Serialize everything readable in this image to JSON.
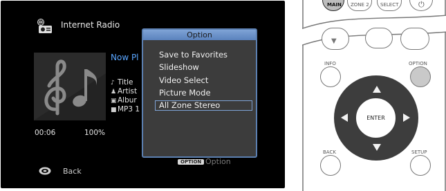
{
  "screen": {
    "app_title": "Internet Radio",
    "now_playing": "Now Pl",
    "tags": [
      {
        "label": "Title"
      },
      {
        "label": "Artist"
      },
      {
        "label": "Albur"
      },
      {
        "label": "MP3 1"
      }
    ],
    "time": "00:06",
    "percent": "100%",
    "back_label": "Back",
    "option_hint_key": "OPTION",
    "option_hint_label": "Option",
    "popup": {
      "title": "Option",
      "items": [
        {
          "label": "Save to Favorites",
          "selected": false
        },
        {
          "label": "Slideshow",
          "selected": false
        },
        {
          "label": "Video Select",
          "selected": false
        },
        {
          "label": "Picture Mode",
          "selected": false
        },
        {
          "label": "All Zone Stereo",
          "selected": true
        }
      ]
    }
  },
  "remote": {
    "top_buttons": [
      "MAIN",
      "ZONE 2",
      "SELECT"
    ],
    "info_label": "INFO",
    "option_label": "OPTION",
    "enter_label": "ENTER",
    "back_label": "BACK",
    "setup_label": "SETUP"
  },
  "colors": {
    "accent": "#5aa6ff",
    "popup_border": "#5b7fb0",
    "option_button": "#c9c9c9"
  }
}
